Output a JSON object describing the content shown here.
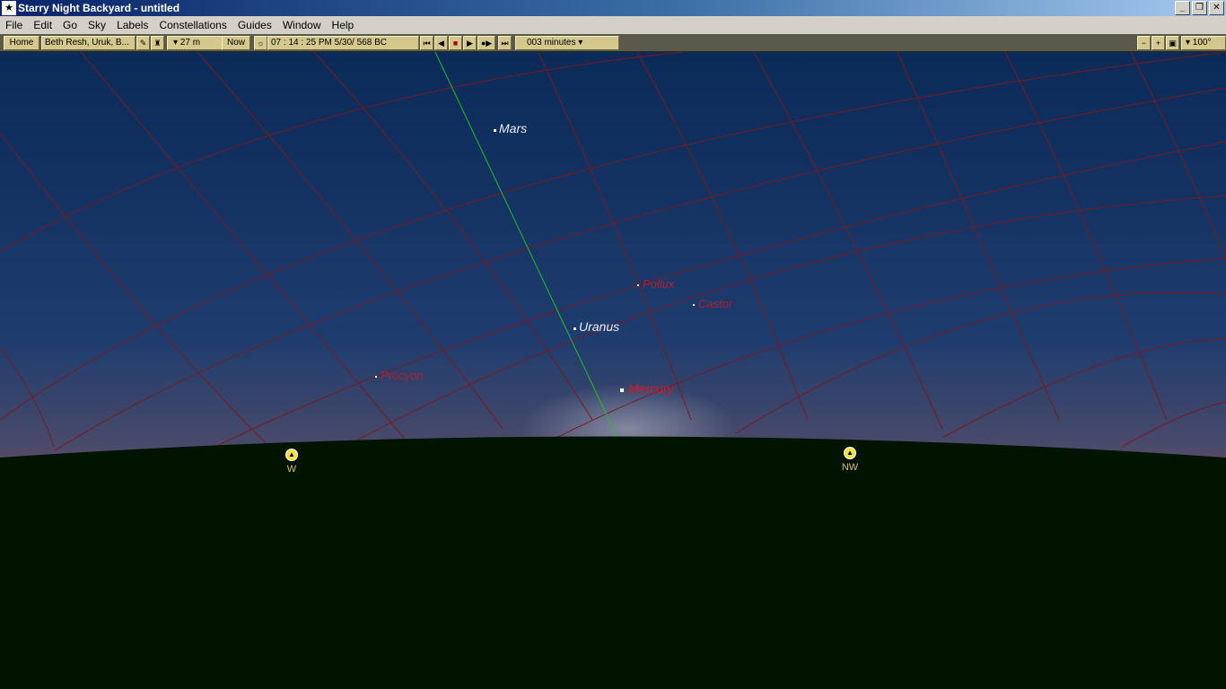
{
  "window": {
    "title": "Starry Night Backyard - untitled",
    "minimize": "_",
    "restore": "❐",
    "close": "✕"
  },
  "menu": [
    "File",
    "Edit",
    "Go",
    "Sky",
    "Labels",
    "Constellations",
    "Guides",
    "Window",
    "Help"
  ],
  "toolbar": {
    "home_label": "Home",
    "location": "Beth Resh, Uruk, B...",
    "elevation": "▾ 27 m",
    "now_label": "Now",
    "time_date": "07 : 14 : 25 PM     5/30/  568 BC",
    "time_step": "003 minutes ▾",
    "fov": "▾ 100°"
  },
  "sky": {
    "planets": [
      {
        "name": "Mars"
      },
      {
        "name": "Uranus"
      },
      {
        "name": "Mercury"
      }
    ],
    "stars": [
      {
        "name": "Pollux"
      },
      {
        "name": "Castor"
      },
      {
        "name": "Procyon"
      }
    ],
    "compass": [
      {
        "dir": "W"
      },
      {
        "dir": "NW"
      }
    ]
  },
  "colors": {
    "sky_top": "#0a2a58",
    "sky_horizon": "#6a4a60",
    "ground": "#001400",
    "grid": "#7a1a1a",
    "ecliptic": "#20c020"
  }
}
